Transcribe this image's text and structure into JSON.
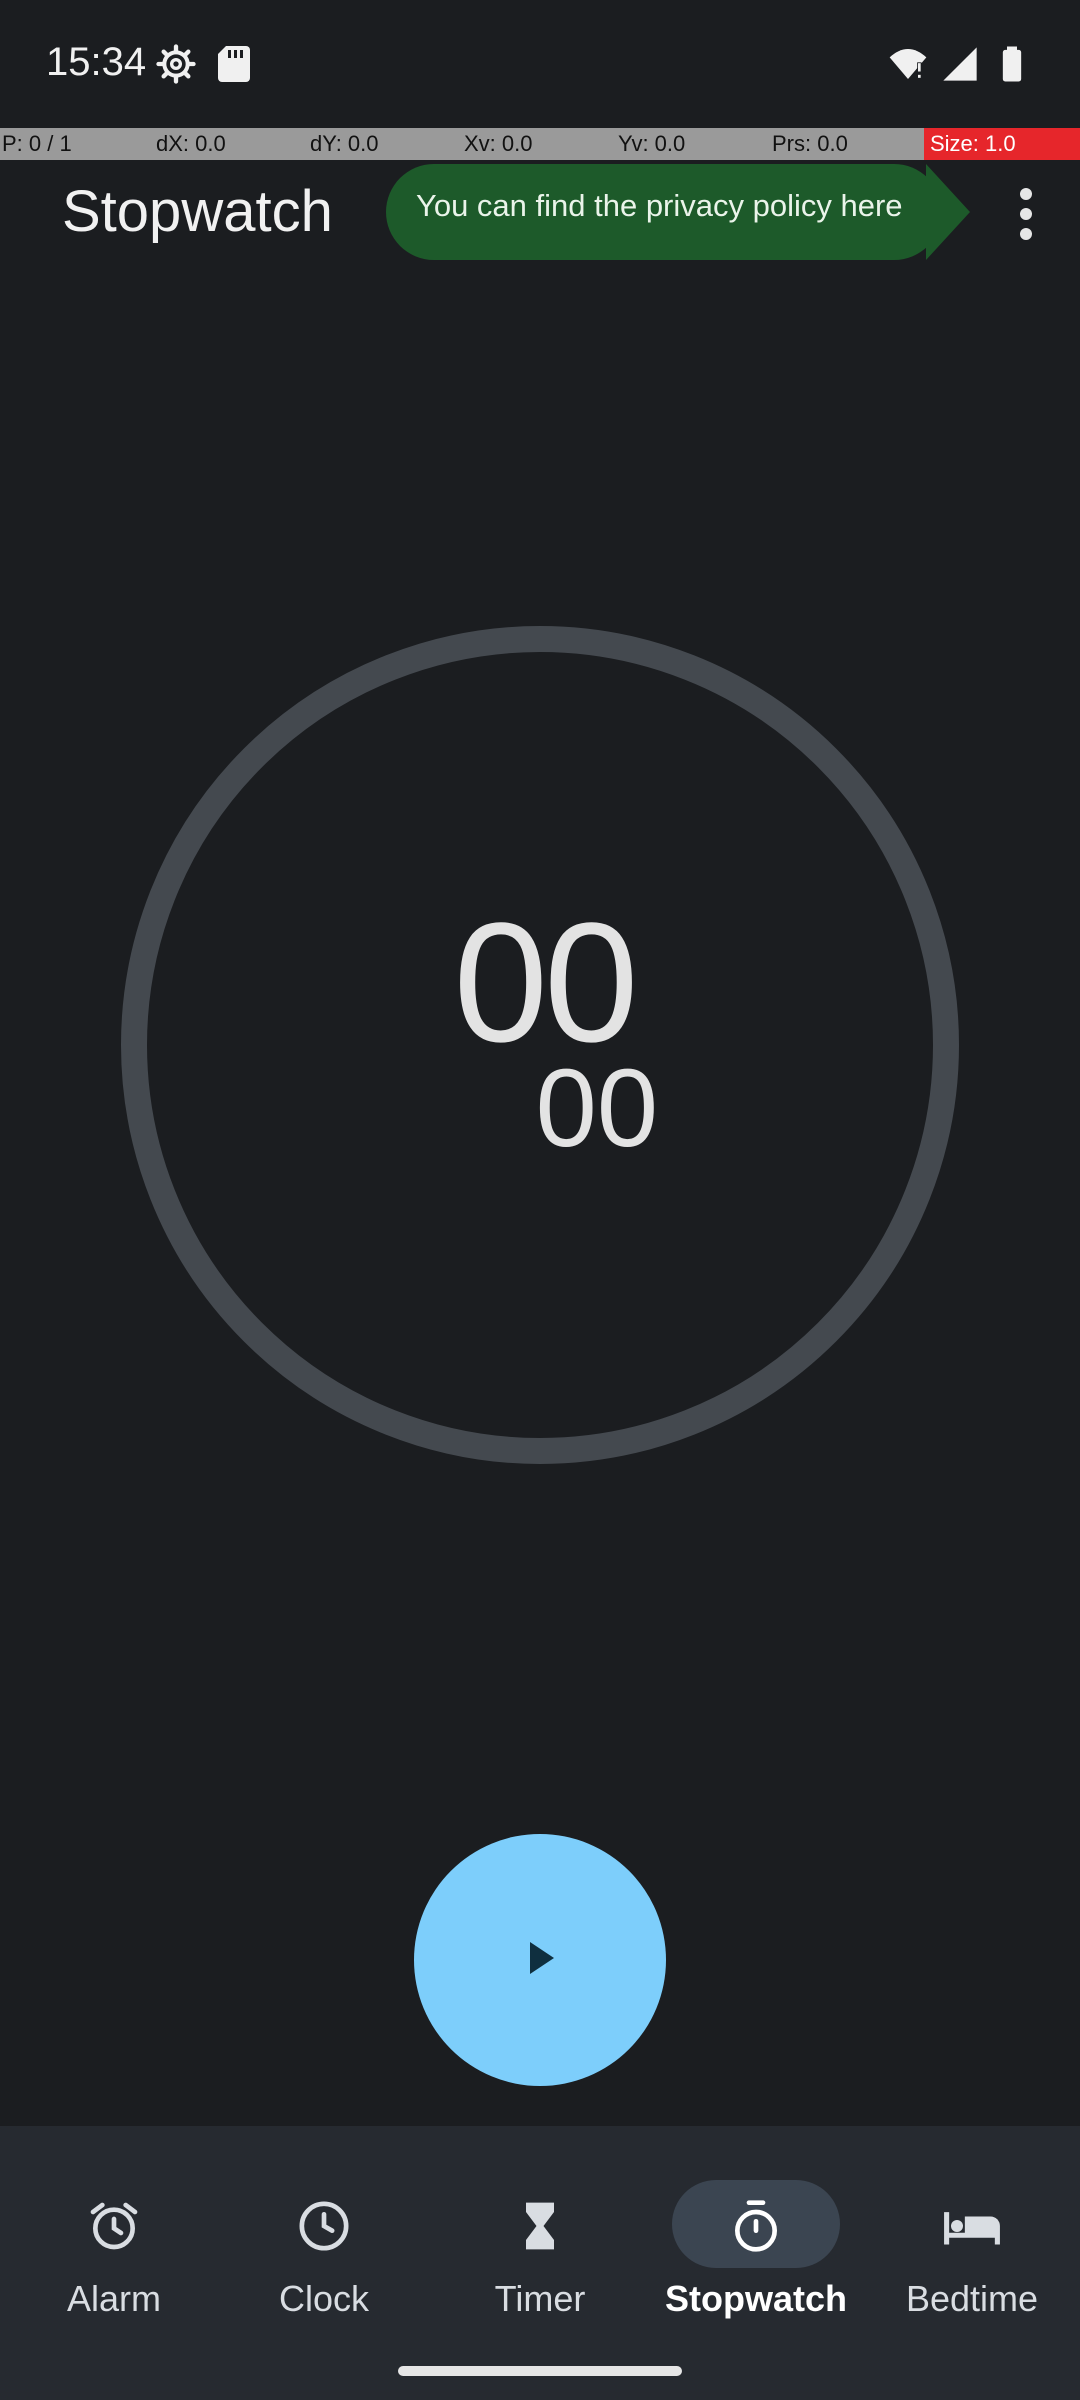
{
  "status_bar": {
    "time": "15:34",
    "icons": [
      "gear-icon",
      "sd-card-icon",
      "wifi-alert-icon",
      "cell-signal-icon",
      "battery-icon"
    ]
  },
  "pointer_location": {
    "p": "P: 0 / 1",
    "dx": "dX: 0.0",
    "dy": "dY: 0.0",
    "xv": "Xv: 0.0",
    "yv": "Yv: 0.0",
    "prs": "Prs: 0.0",
    "size": "Size: 1.0"
  },
  "app_bar": {
    "title": "Stopwatch",
    "tooltip": "You can find the privacy policy here",
    "overflow_icon": "more-vert-icon"
  },
  "stopwatch": {
    "seconds": "00",
    "hundredths": "00"
  },
  "fab": {
    "icon": "play-icon"
  },
  "bottom_nav": {
    "items": [
      {
        "label": "Alarm",
        "icon": "alarm-icon",
        "active": false
      },
      {
        "label": "Clock",
        "icon": "clock-icon",
        "active": false
      },
      {
        "label": "Timer",
        "icon": "hourglass-icon",
        "active": false
      },
      {
        "label": "Stopwatch",
        "icon": "stopwatch-icon",
        "active": true
      },
      {
        "label": "Bedtime",
        "icon": "bed-icon",
        "active": false
      }
    ]
  },
  "colors": {
    "background": "#1b1d20",
    "dial_ring": "#44494f",
    "fab": "#7dcefb",
    "tooltip": "#1d5a2a",
    "nav_bar": "#262a30",
    "nav_active_pill": "#3b4551"
  }
}
